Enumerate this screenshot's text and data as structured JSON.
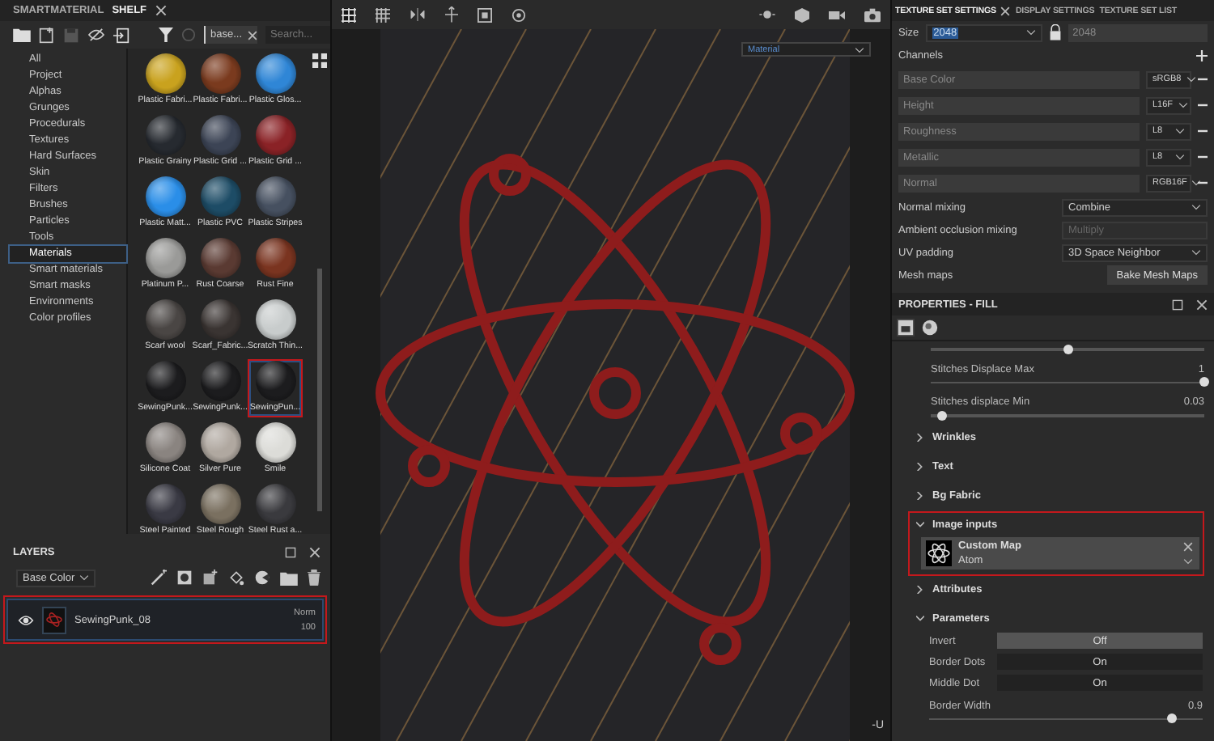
{
  "shelf": {
    "tabs": [
      {
        "label": "SMARTMATERIAL",
        "selected": false
      },
      {
        "label": "SHELF",
        "selected": true
      }
    ],
    "filter": {
      "value": "base..."
    },
    "search": {
      "placeholder": "Search..."
    },
    "categories": [
      {
        "label": "All",
        "selected": false
      },
      {
        "label": "Project",
        "selected": false
      },
      {
        "label": "Alphas",
        "selected": false
      },
      {
        "label": "Grunges",
        "selected": false
      },
      {
        "label": "Procedurals",
        "selected": false
      },
      {
        "label": "Textures",
        "selected": false
      },
      {
        "label": "Hard Surfaces",
        "selected": false
      },
      {
        "label": "Skin",
        "selected": false
      },
      {
        "label": "Filters",
        "selected": false
      },
      {
        "label": "Brushes",
        "selected": false
      },
      {
        "label": "Particles",
        "selected": false
      },
      {
        "label": "Tools",
        "selected": false
      },
      {
        "label": "Materials",
        "selected": true
      },
      {
        "label": "Smart materials",
        "selected": false
      },
      {
        "label": "Smart masks",
        "selected": false
      },
      {
        "label": "Environments",
        "selected": false
      },
      {
        "label": "Color profiles",
        "selected": false
      }
    ],
    "materials": [
      {
        "name": "Plastic Fabri...",
        "color": "#c9a21e",
        "selected": false
      },
      {
        "name": "Plastic Fabri...",
        "color": "#7a3a1e",
        "selected": false
      },
      {
        "name": "Plastic Glos...",
        "color": "#2f86d6",
        "selected": false
      },
      {
        "name": "Plastic Grainy",
        "color": "#262a30",
        "selected": false
      },
      {
        "name": "Plastic Grid ...",
        "color": "#3c4455",
        "selected": false
      },
      {
        "name": "Plastic Grid ...",
        "color": "#8a2226",
        "selected": false
      },
      {
        "name": "Plastic Matt...",
        "color": "#2a8ee8",
        "selected": false
      },
      {
        "name": "Plastic PVC",
        "color": "#1d4c66",
        "selected": false
      },
      {
        "name": "Plastic Stripes",
        "color": "#465060",
        "selected": false
      },
      {
        "name": "Platinum P...",
        "color": "#9a9a98",
        "selected": false
      },
      {
        "name": "Rust Coarse",
        "color": "#5a3a32",
        "selected": false
      },
      {
        "name": "Rust Fine",
        "color": "#7a3420",
        "selected": false
      },
      {
        "name": "Scarf wool",
        "color": "#4a4644",
        "selected": false
      },
      {
        "name": "Scarf_Fabric...",
        "color": "#3a3432",
        "selected": false
      },
      {
        "name": "Scratch Thin...",
        "color": "#c8cccc",
        "selected": false
      },
      {
        "name": "SewingPunk...",
        "color": "#1c1c1e",
        "selected": false
      },
      {
        "name": "SewingPunk...",
        "color": "#1c1c1e",
        "selected": false
      },
      {
        "name": "SewingPun...",
        "color": "#1c1c1e",
        "selected": true
      },
      {
        "name": "Silicone Coat",
        "color": "#8a8480",
        "selected": false
      },
      {
        "name": "Silver Pure",
        "color": "#b0a8a0",
        "selected": false
      },
      {
        "name": "Smile",
        "color": "#dcdcd8",
        "selected": false
      },
      {
        "name": "Steel Painted",
        "color": "#3a3a44",
        "selected": false
      },
      {
        "name": "Steel Rough",
        "color": "#7a7060",
        "selected": false
      },
      {
        "name": "Steel Rust a...",
        "color": "#3a3a3e",
        "selected": false
      }
    ]
  },
  "layers": {
    "title": "LAYERS",
    "channel": "Base Color",
    "rows": [
      {
        "name": "SewingPunk_08",
        "blend": "Norm",
        "opacity": "100",
        "visible": true,
        "highlighted": true
      }
    ]
  },
  "viewport": {
    "view_mode": "Material",
    "axis_label": "-U"
  },
  "texture_set_settings": {
    "tabs": [
      {
        "label": "TEXTURE SET SETTINGS",
        "selected": true
      },
      {
        "label": "DISPLAY SETTINGS",
        "selected": false
      },
      {
        "label": "TEXTURE SET LIST",
        "selected": false
      }
    ],
    "size_label": "Size",
    "size": "2048",
    "size_linked": "2048",
    "channels_label": "Channels",
    "channels": [
      {
        "name": "Base Color",
        "format": "sRGB8"
      },
      {
        "name": "Height",
        "format": "L16F"
      },
      {
        "name": "Roughness",
        "format": "L8"
      },
      {
        "name": "Metallic",
        "format": "L8"
      },
      {
        "name": "Normal",
        "format": "RGB16F"
      }
    ],
    "settings": [
      {
        "label": "Normal mixing",
        "value": "Combine",
        "disabled": false
      },
      {
        "label": "Ambient occlusion mixing",
        "value": "Multiply",
        "disabled": true
      },
      {
        "label": "UV padding",
        "value": "3D Space Neighbor",
        "disabled": false
      }
    ],
    "mesh_maps": {
      "label": "Mesh maps",
      "button": "Bake Mesh Maps"
    }
  },
  "properties": {
    "title": "PROPERTIES - FILL",
    "sliders": [
      {
        "level": 0.5
      },
      {
        "label": "Stitches Displace Max",
        "reading": "1",
        "level": 1
      },
      {
        "label": "Stitches displace Min",
        "reading": "0.03",
        "level": 0.04
      }
    ],
    "sections": [
      {
        "label": "Wrinkles",
        "expanded": false,
        "highlighted": false
      },
      {
        "label": "Text",
        "expanded": false,
        "highlighted": false
      },
      {
        "label": "Bg Fabric",
        "expanded": false,
        "highlighted": false
      },
      {
        "label": "Image inputs",
        "expanded": true,
        "highlighted": true,
        "items": [
          {
            "kind": "image_input",
            "title": "Custom Map",
            "value": "Atom"
          }
        ]
      },
      {
        "label": "Attributes",
        "expanded": false,
        "highlighted": false
      },
      {
        "label": "Parameters",
        "expanded": true,
        "highlighted": false,
        "items": [
          {
            "kind": "toggle",
            "label": "Invert",
            "value": "Off",
            "on": false
          },
          {
            "kind": "toggle",
            "label": "Border Dots",
            "value": "On",
            "on": true
          },
          {
            "kind": "toggle",
            "label": "Middle Dot",
            "value": "On",
            "on": true
          },
          {
            "kind": "slider",
            "label": "Border Width",
            "reading": "0.9",
            "level": 0.89
          }
        ]
      }
    ]
  }
}
